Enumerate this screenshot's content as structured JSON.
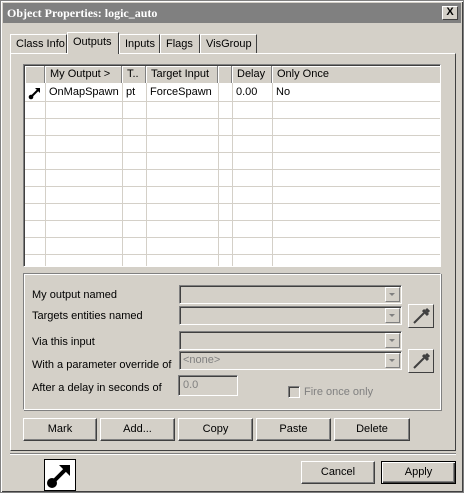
{
  "window": {
    "title": "Object Properties: logic_auto",
    "close_glyph": "X"
  },
  "tabs": [
    {
      "label": "Class Info",
      "active": false
    },
    {
      "label": "Outputs",
      "active": true
    },
    {
      "label": "Inputs",
      "active": false
    },
    {
      "label": "Flags",
      "active": false
    },
    {
      "label": "VisGroup",
      "active": false
    }
  ],
  "outputs_table": {
    "columns": [
      "My Output  >",
      "T..",
      "Target Input",
      "",
      "Delay",
      "Only Once"
    ],
    "rows": [
      {
        "icon": "output-connection-icon",
        "output": "OnMapSpawn",
        "target": "pt",
        "input": "ForceSpawn",
        "delay": "0.00",
        "once": "No"
      }
    ]
  },
  "form": {
    "output_named_label": "My output named",
    "targets_named_label": "Targets entities named",
    "via_input_label": "Via this input",
    "param_override_label": "With a parameter override of",
    "param_override_value": "<none>",
    "delay_label": "After a delay in seconds of",
    "delay_value": "0.0",
    "fire_once_label": "Fire once only"
  },
  "action_buttons": {
    "mark": "Mark",
    "add": "Add...",
    "copy": "Copy",
    "paste": "Paste",
    "delete": "Delete"
  },
  "dialog_buttons": {
    "cancel": "Cancel",
    "apply": "Apply"
  },
  "icons": {
    "eyedropper": "eyedropper-icon",
    "entity": "entity-connection-icon"
  },
  "colors": {
    "face": "#d4d0c8",
    "title_inactive": "#808080",
    "disabled_text": "#808080"
  }
}
